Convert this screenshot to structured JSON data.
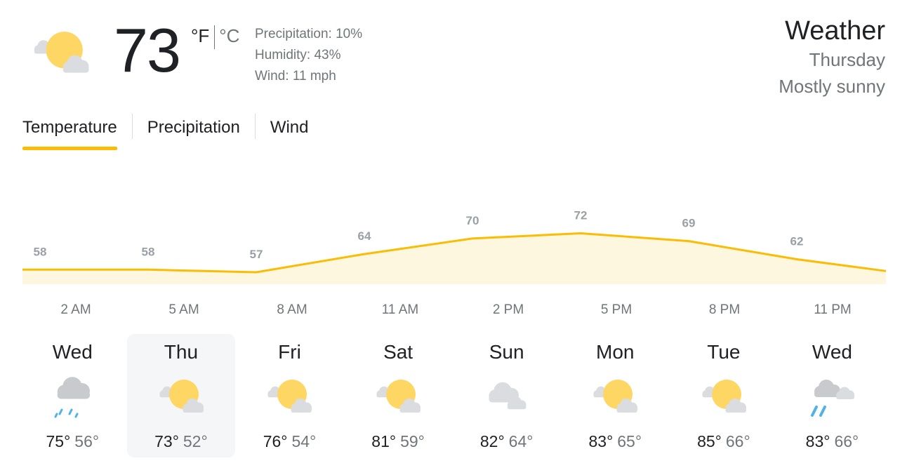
{
  "current": {
    "icon": "partly-sunny-icon",
    "temperature": "73",
    "unit_f": "°F",
    "unit_c": "°C",
    "precipitation": "Precipitation: 10%",
    "humidity": "Humidity: 43%",
    "wind": "Wind: 11 mph"
  },
  "title": {
    "heading": "Weather",
    "day": "Thursday",
    "condition": "Mostly sunny"
  },
  "tabs": [
    {
      "label": "Temperature",
      "active": true
    },
    {
      "label": "Precipitation",
      "active": false
    },
    {
      "label": "Wind",
      "active": false
    }
  ],
  "colors": {
    "accent": "#fbbc04",
    "fill": "#fef7e0",
    "text_primary": "#202124",
    "text_secondary": "#70757a",
    "selected_bg": "#f5f6f7"
  },
  "chart_data": {
    "type": "area",
    "x": [
      "2 AM",
      "5 AM",
      "8 AM",
      "11 AM",
      "2 PM",
      "5 PM",
      "8 PM",
      "11 PM"
    ],
    "values": [
      58,
      58,
      57,
      64,
      70,
      72,
      69,
      62
    ],
    "tick_labels": [
      "2 AM",
      "5 AM",
      "8 AM",
      "11 AM",
      "2 PM",
      "5 PM",
      "8 PM",
      "11 PM"
    ],
    "xlabel": "",
    "ylabel": ""
  },
  "forecast": [
    {
      "day": "Wed",
      "icon": "rain-icon",
      "high": "75°",
      "low": "56°",
      "selected": false
    },
    {
      "day": "Thu",
      "icon": "partly-sunny-icon",
      "high": "73°",
      "low": "52°",
      "selected": true
    },
    {
      "day": "Fri",
      "icon": "partly-sunny-icon",
      "high": "76°",
      "low": "54°",
      "selected": false
    },
    {
      "day": "Sat",
      "icon": "partly-sunny-icon",
      "high": "81°",
      "low": "59°",
      "selected": false
    },
    {
      "day": "Sun",
      "icon": "cloudy-icon",
      "high": "82°",
      "low": "64°",
      "selected": false
    },
    {
      "day": "Mon",
      "icon": "partly-sunny-icon",
      "high": "83°",
      "low": "65°",
      "selected": false
    },
    {
      "day": "Tue",
      "icon": "partly-sunny-icon",
      "high": "85°",
      "low": "66°",
      "selected": false
    },
    {
      "day": "Wed",
      "icon": "showers-icon",
      "high": "83°",
      "low": "66°",
      "selected": false
    }
  ]
}
